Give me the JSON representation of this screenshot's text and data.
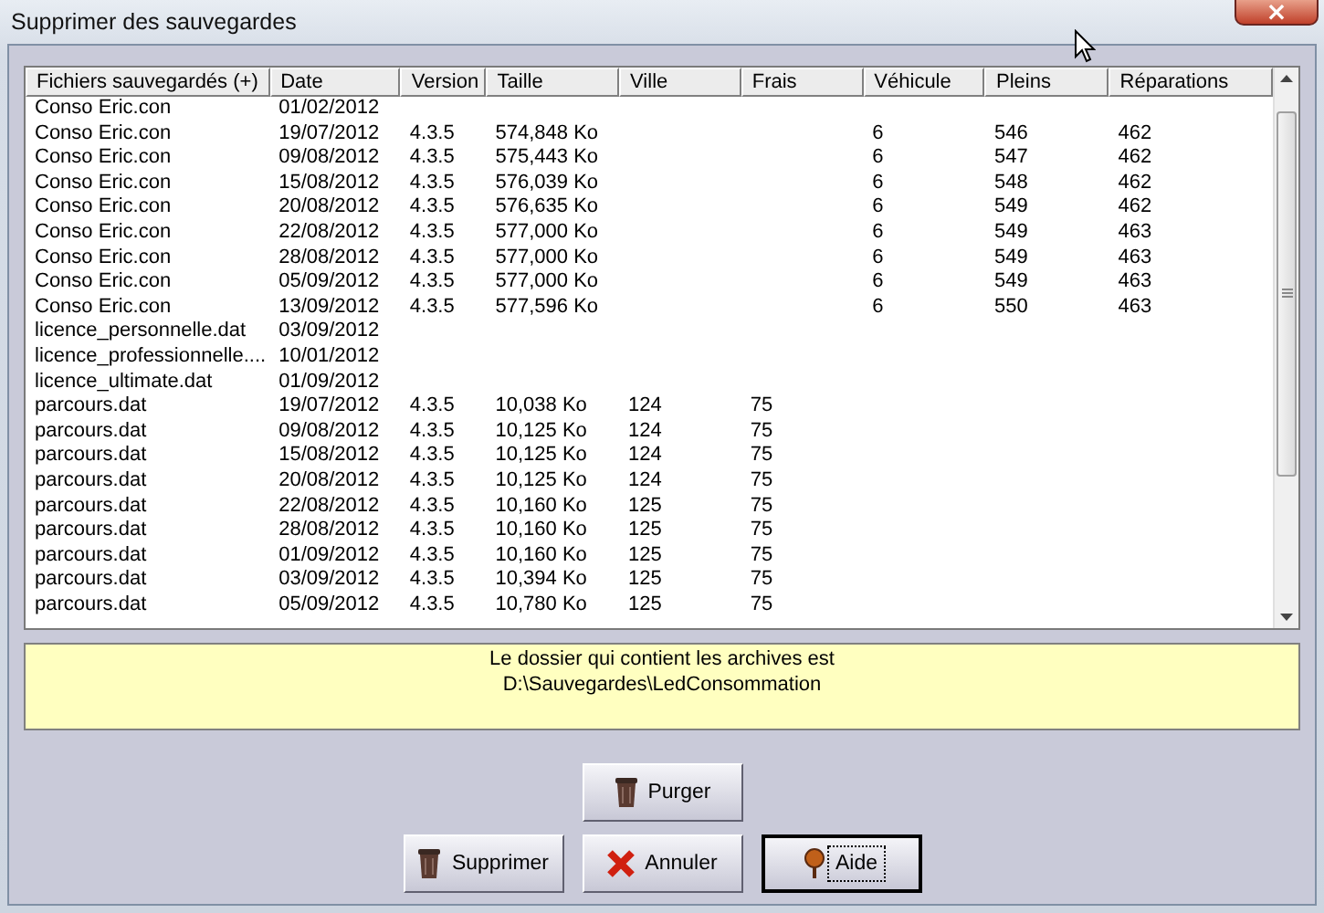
{
  "window": {
    "title": "Supprimer des sauvegardes",
    "close": "×"
  },
  "table": {
    "columns": [
      "Fichiers sauvegardés (+)",
      "Date",
      "Version",
      "Taille",
      "Ville",
      "Frais",
      "Véhicule",
      "Pleins",
      "Réparations"
    ],
    "rows": [
      {
        "fichier": "Conso Eric.con",
        "date": "01/02/2012"
      },
      {
        "fichier": "Conso Eric.con",
        "date": "19/07/2012",
        "version": "4.3.5",
        "taille": "574,848 Ko",
        "vehicule": "6",
        "pleins": "546",
        "reparations": "462"
      },
      {
        "fichier": "Conso Eric.con",
        "date": "09/08/2012",
        "version": "4.3.5",
        "taille": "575,443 Ko",
        "vehicule": "6",
        "pleins": "547",
        "reparations": "462"
      },
      {
        "fichier": "Conso Eric.con",
        "date": "15/08/2012",
        "version": "4.3.5",
        "taille": "576,039 Ko",
        "vehicule": "6",
        "pleins": "548",
        "reparations": "462"
      },
      {
        "fichier": "Conso Eric.con",
        "date": "20/08/2012",
        "version": "4.3.5",
        "taille": "576,635 Ko",
        "vehicule": "6",
        "pleins": "549",
        "reparations": "462"
      },
      {
        "fichier": "Conso Eric.con",
        "date": "22/08/2012",
        "version": "4.3.5",
        "taille": "577,000 Ko",
        "vehicule": "6",
        "pleins": "549",
        "reparations": "463"
      },
      {
        "fichier": "Conso Eric.con",
        "date": "28/08/2012",
        "version": "4.3.5",
        "taille": "577,000 Ko",
        "vehicule": "6",
        "pleins": "549",
        "reparations": "463"
      },
      {
        "fichier": "Conso Eric.con",
        "date": "05/09/2012",
        "version": "4.3.5",
        "taille": "577,000 Ko",
        "vehicule": "6",
        "pleins": "549",
        "reparations": "463"
      },
      {
        "fichier": "Conso Eric.con",
        "date": "13/09/2012",
        "version": "4.3.5",
        "taille": "577,596 Ko",
        "vehicule": "6",
        "pleins": "550",
        "reparations": "463"
      },
      {
        "fichier": "licence_personnelle.dat",
        "date": "03/09/2012"
      },
      {
        "fichier": "licence_professionnelle....",
        "date": "10/01/2012"
      },
      {
        "fichier": "licence_ultimate.dat",
        "date": "01/09/2012"
      },
      {
        "fichier": "parcours.dat",
        "date": "19/07/2012",
        "version": "4.3.5",
        "taille": "10,038 Ko",
        "ville": "124",
        "frais": "75"
      },
      {
        "fichier": "parcours.dat",
        "date": "09/08/2012",
        "version": "4.3.5",
        "taille": "10,125 Ko",
        "ville": "124",
        "frais": "75"
      },
      {
        "fichier": "parcours.dat",
        "date": "15/08/2012",
        "version": "4.3.5",
        "taille": "10,125 Ko",
        "ville": "124",
        "frais": "75"
      },
      {
        "fichier": "parcours.dat",
        "date": "20/08/2012",
        "version": "4.3.5",
        "taille": "10,125 Ko",
        "ville": "124",
        "frais": "75"
      },
      {
        "fichier": "parcours.dat",
        "date": "22/08/2012",
        "version": "4.3.5",
        "taille": "10,160 Ko",
        "ville": "125",
        "frais": "75"
      },
      {
        "fichier": "parcours.dat",
        "date": "28/08/2012",
        "version": "4.3.5",
        "taille": "10,160 Ko",
        "ville": "125",
        "frais": "75"
      },
      {
        "fichier": "parcours.dat",
        "date": "01/09/2012",
        "version": "4.3.5",
        "taille": "10,160 Ko",
        "ville": "125",
        "frais": "75"
      },
      {
        "fichier": "parcours.dat",
        "date": "03/09/2012",
        "version": "4.3.5",
        "taille": "10,394 Ko",
        "ville": "125",
        "frais": "75"
      },
      {
        "fichier": "parcours.dat",
        "date": "05/09/2012",
        "version": "4.3.5",
        "taille": "10,780 Ko",
        "ville": "125",
        "frais": "75"
      }
    ]
  },
  "info": [
    "Le dossier qui contient les archives est",
    "D:\\Sauvegardes\\LedConsommation"
  ],
  "buttons": [
    {
      "label": "Purger",
      "kind": "trash",
      "focused": false
    },
    {
      "label": "Supprimer",
      "kind": "trash",
      "focused": false
    },
    {
      "label": "Annuler",
      "kind": "cancel",
      "focused": false
    },
    {
      "label": "Aide",
      "kind": "help",
      "focused": true
    }
  ]
}
